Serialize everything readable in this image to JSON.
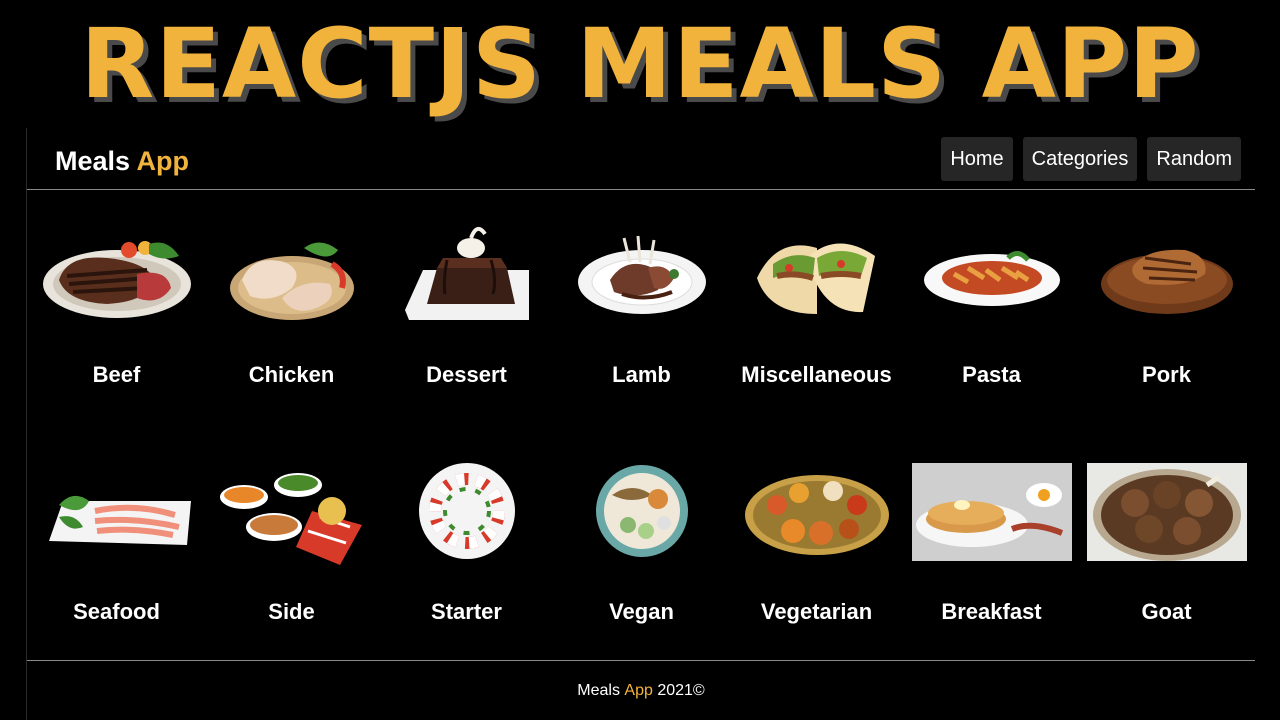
{
  "banner": {
    "title": "REACTJS MEALS APP"
  },
  "navbar": {
    "brand_main": "Meals",
    "brand_accent": "App",
    "links": [
      "Home",
      "Categories",
      "Random"
    ]
  },
  "categories": [
    {
      "name": "Beef",
      "icon": "beef-image"
    },
    {
      "name": "Chicken",
      "icon": "chicken-image"
    },
    {
      "name": "Dessert",
      "icon": "dessert-image"
    },
    {
      "name": "Lamb",
      "icon": "lamb-image"
    },
    {
      "name": "Miscellaneous",
      "icon": "miscellaneous-image"
    },
    {
      "name": "Pasta",
      "icon": "pasta-image"
    },
    {
      "name": "Pork",
      "icon": "pork-image"
    },
    {
      "name": "Seafood",
      "icon": "seafood-image"
    },
    {
      "name": "Side",
      "icon": "side-image"
    },
    {
      "name": "Starter",
      "icon": "starter-image"
    },
    {
      "name": "Vegan",
      "icon": "vegan-image"
    },
    {
      "name": "Vegetarian",
      "icon": "vegetarian-image"
    },
    {
      "name": "Breakfast",
      "icon": "breakfast-image"
    },
    {
      "name": "Goat",
      "icon": "goat-image"
    }
  ],
  "footer": {
    "brand_main": "Meals",
    "brand_accent": "App",
    "suffix": "2021©"
  },
  "colors": {
    "accent": "#f2b33d",
    "background": "#000000",
    "nav_button": "#262626"
  }
}
